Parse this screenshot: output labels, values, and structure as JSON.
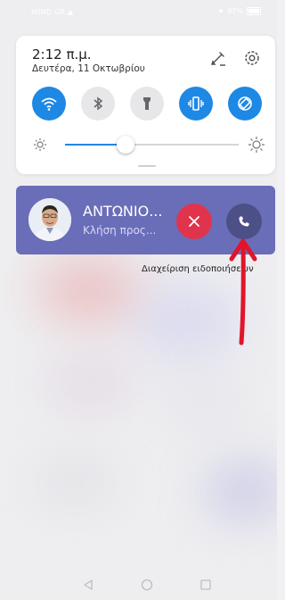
{
  "status_bar": {
    "carrier": "WIND GR",
    "battery": "97%"
  },
  "quick_settings": {
    "time": "2:12 π.μ.",
    "date": "Δευτέρα, 11 Οκτωβρίου",
    "tiles": [
      {
        "name": "wifi",
        "state": "on"
      },
      {
        "name": "bluetooth",
        "state": "off"
      },
      {
        "name": "flashlight",
        "state": "off"
      },
      {
        "name": "vibrate",
        "state": "on"
      },
      {
        "name": "auto-rotate",
        "state": "on"
      }
    ],
    "brightness": 0.35
  },
  "notification": {
    "caller": "ΑΝΤΩΝΙΟ...",
    "subtitle": "Κλήση προς...",
    "accent": "#6a6db8",
    "decline_color": "#e0344c"
  },
  "manage_notifications": "Διαχείριση ειδοποιήσεων",
  "colors": {
    "active": "#1e88e5",
    "arrow": "#e0152b"
  }
}
